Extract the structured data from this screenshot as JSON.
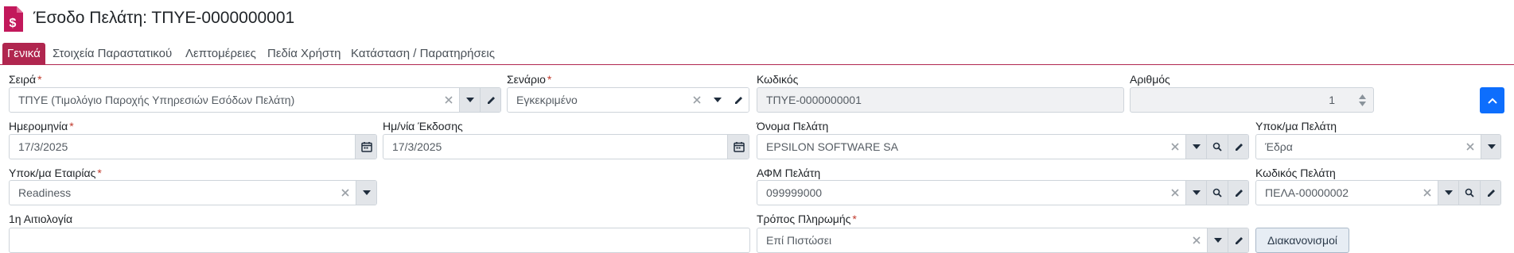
{
  "header": {
    "title": "Έσοδο Πελάτη: ΤΠΥΕ-0000000001"
  },
  "tabs": [
    {
      "label": "Γενικά",
      "active": true
    },
    {
      "label": "Στοιχεία Παραστατικού",
      "active": false
    },
    {
      "label": "Λεπτομέρειες",
      "active": false
    },
    {
      "label": "Πεδία Χρήστη",
      "active": false
    },
    {
      "label": "Κατάσταση / Παρατηρήσεις",
      "active": false
    }
  ],
  "fields": {
    "seira": {
      "label": "Σειρά",
      "required": "*",
      "value": "ΤΠΥΕ (Τιμολόγιο Παροχής Υπηρεσιών Εσόδων Πελάτη)"
    },
    "senario": {
      "label": "Σενάριο",
      "required": "*",
      "value": "Εγκεκριμένο"
    },
    "kodikos": {
      "label": "Κωδικός",
      "value": "ΤΠΥΕ-0000000001"
    },
    "arithmos": {
      "label": "Αριθμός",
      "value": "1"
    },
    "imerominia": {
      "label": "Ημερομηνία",
      "required": "*",
      "value": "17/3/2025"
    },
    "imnia_ekdosis": {
      "label": "Ημ/νία Έκδοσης",
      "value": "17/3/2025"
    },
    "onoma_pelati": {
      "label": "Όνομα Πελάτη",
      "value": "EPSILON SOFTWARE SA"
    },
    "ypokma_pelati": {
      "label": "Υποκ/μα Πελάτη",
      "value": "Έδρα"
    },
    "ypokma_etairias": {
      "label": "Υποκ/μα Εταιρίας",
      "required": "*",
      "value": "Readiness"
    },
    "afm_pelati": {
      "label": "ΑΦΜ Πελάτη",
      "value": "099999000"
    },
    "kodikos_pelati": {
      "label": "Κωδικός Πελάτη",
      "value": "ΠΕΛΑ-00000002"
    },
    "aitiologia": {
      "label": "1η Αιτιολογία",
      "value": ""
    },
    "tropos_pliromis": {
      "label": "Τρόπος Πληρωμής",
      "required": "*",
      "value": "Επί Πιστώσει"
    }
  },
  "buttons": {
    "diakanonismoi": "Διακανονισμοί"
  },
  "colors": {
    "accent": "#b0264f",
    "primary": "#0d6efd",
    "required": "#c0392b"
  }
}
